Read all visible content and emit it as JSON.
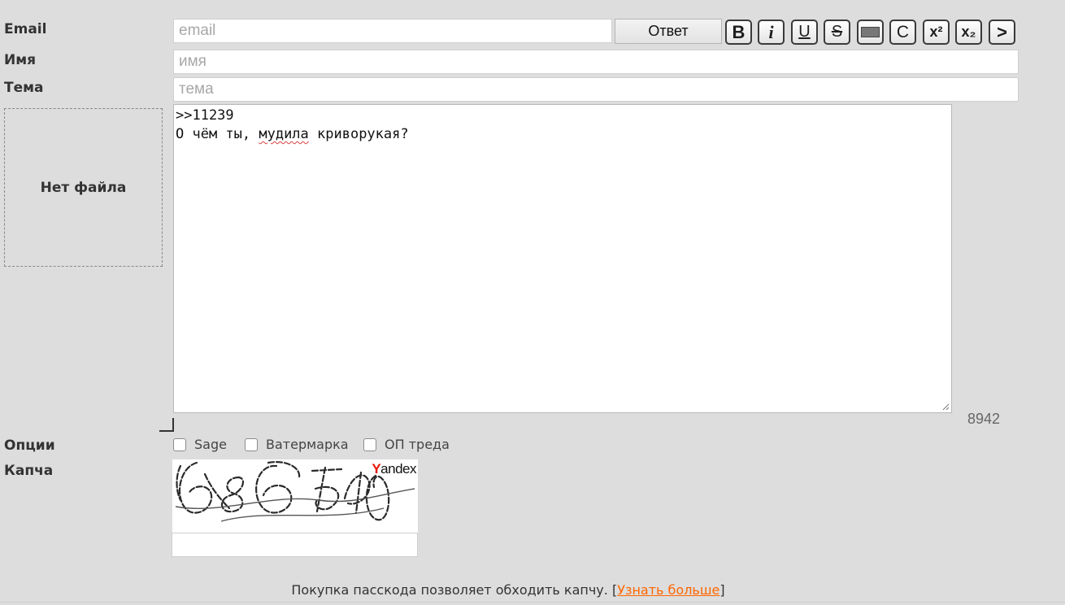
{
  "labels": {
    "email": "Email",
    "name": "Имя",
    "subject": "Тема",
    "options": "Опции",
    "captcha": "Капча"
  },
  "email_field": {
    "placeholder": "email",
    "value": ""
  },
  "name_field": {
    "placeholder": "имя",
    "value": ""
  },
  "subject_field": {
    "placeholder": "тема",
    "value": ""
  },
  "reply_button": "Ответ",
  "markup_buttons": [
    {
      "name": "bold",
      "label": "B"
    },
    {
      "name": "italic",
      "label": "i"
    },
    {
      "name": "underline",
      "label": "U"
    },
    {
      "name": "strikethrough",
      "label": "S"
    },
    {
      "name": "spoiler",
      "label": ""
    },
    {
      "name": "code",
      "label": "C"
    },
    {
      "name": "superscript",
      "label": "x²"
    },
    {
      "name": "subscript",
      "label": "x₂"
    },
    {
      "name": "quote",
      "label": ">"
    }
  ],
  "file_drop": "Нет файла",
  "comment": {
    "line1": ">>11239",
    "line2_before": "О чём ты, ",
    "line2_misspelled": "мудила",
    "line2_after": " криворукая?"
  },
  "char_counter": "8942",
  "options": [
    {
      "label": "Sage",
      "checked": false
    },
    {
      "label": "Ватермарка",
      "checked": false
    },
    {
      "label": "ОП треда",
      "checked": false
    }
  ],
  "captcha": {
    "brand_first": "Y",
    "brand_rest": "andex",
    "answer": ""
  },
  "promo": {
    "text": "Покупка пасскода позволяет обходить капчу. [",
    "link": "Узнать больше",
    "close": "]"
  },
  "colors": {
    "background": "#dddddd",
    "link": "#ff6600",
    "yandex_red": "#e61400"
  }
}
